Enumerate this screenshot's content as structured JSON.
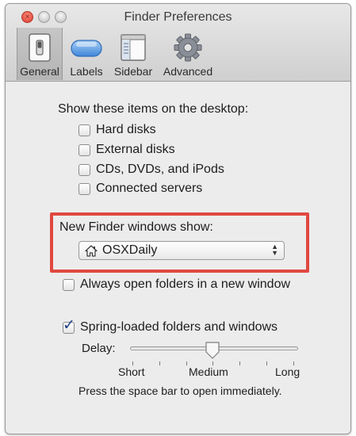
{
  "window": {
    "title": "Finder Preferences"
  },
  "toolbar": {
    "items": [
      {
        "label": "General",
        "icon": "general-switch-icon",
        "selected": true
      },
      {
        "label": "Labels",
        "icon": "labels-pill-icon",
        "selected": false
      },
      {
        "label": "Sidebar",
        "icon": "sidebar-window-icon",
        "selected": false
      },
      {
        "label": "Advanced",
        "icon": "gear-icon",
        "selected": false
      }
    ]
  },
  "desktop": {
    "heading": "Show these items on the desktop:",
    "items": [
      {
        "label": "Hard disks",
        "checked": false
      },
      {
        "label": "External disks",
        "checked": false
      },
      {
        "label": "CDs, DVDs, and iPods",
        "checked": false
      },
      {
        "label": "Connected servers",
        "checked": false
      }
    ]
  },
  "new_window": {
    "heading": "New Finder windows show:",
    "selected": "OSXDaily",
    "icon": "home-icon"
  },
  "always_open": {
    "label": "Always open folders in a new window",
    "checked": false
  },
  "spring_loaded": {
    "label": "Spring-loaded folders and windows",
    "checked": true,
    "delay_label": "Delay:",
    "delay_value": "Medium",
    "ticks": [
      "Short",
      "Medium",
      "Long"
    ],
    "hint": "Press the space bar to open immediately."
  },
  "colors": {
    "highlight": "#e0483f",
    "check": "#1e3e86"
  }
}
